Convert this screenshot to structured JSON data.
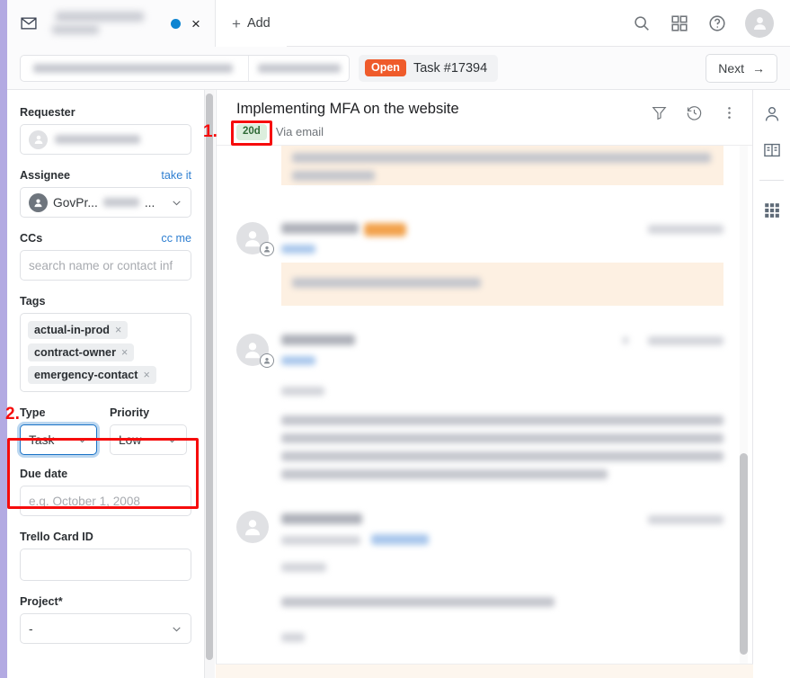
{
  "window": {
    "tab": {
      "icon": "envelope-icon",
      "unread_dot": "unread-dot",
      "close": "×"
    },
    "add_tab_label": "Add",
    "header_icons": [
      "search-icon",
      "apps-grid-icon",
      "help-circle-icon",
      "user-avatar"
    ]
  },
  "breadcrumb": {
    "status_badge": "Open",
    "task_id": "Task #17394",
    "next_label": "Next",
    "next_arrow": "→"
  },
  "sidebar": {
    "requester": {
      "label": "Requester"
    },
    "assignee": {
      "label": "Assignee",
      "action": "take it",
      "value": "GovPr...",
      "value_suffix": "..."
    },
    "ccs": {
      "label": "CCs",
      "action": "cc me",
      "placeholder": "search name or contact inf"
    },
    "tags": {
      "label": "Tags",
      "items": [
        {
          "name": "actual-in-prod",
          "remove": "×"
        },
        {
          "name": "contract-owner",
          "remove": "×"
        },
        {
          "name": "emergency-contact",
          "remove": "×"
        }
      ]
    },
    "type": {
      "label": "Type",
      "value": "Task"
    },
    "priority": {
      "label": "Priority",
      "value": "Low"
    },
    "due_date": {
      "label": "Due date",
      "placeholder": "e.g. October 1, 2008"
    },
    "trello": {
      "label": "Trello Card ID",
      "value": ""
    },
    "project": {
      "label": "Project*",
      "value": "-"
    }
  },
  "conversation": {
    "title": "Implementing MFA on the website",
    "age_badge": "20d",
    "source": "Via email",
    "icons": [
      "filter-icon",
      "history-icon",
      "more-vertical-icon"
    ]
  },
  "right_rail": {
    "icons": [
      "person-icon",
      "contact-card-icon",
      "apps-grid-icon"
    ]
  },
  "annotations": [
    {
      "number": "1."
    },
    {
      "number": "2."
    }
  ],
  "colors": {
    "accent_orange": "#ef5b2b",
    "badge_green_bg": "#dceedd",
    "badge_green_text": "#2f6a36",
    "focus_blue": "#1a73c7",
    "link_blue": "#2f7fd1",
    "annotation_red": "#f60c0c",
    "edge_purple": "#b3aae2"
  }
}
